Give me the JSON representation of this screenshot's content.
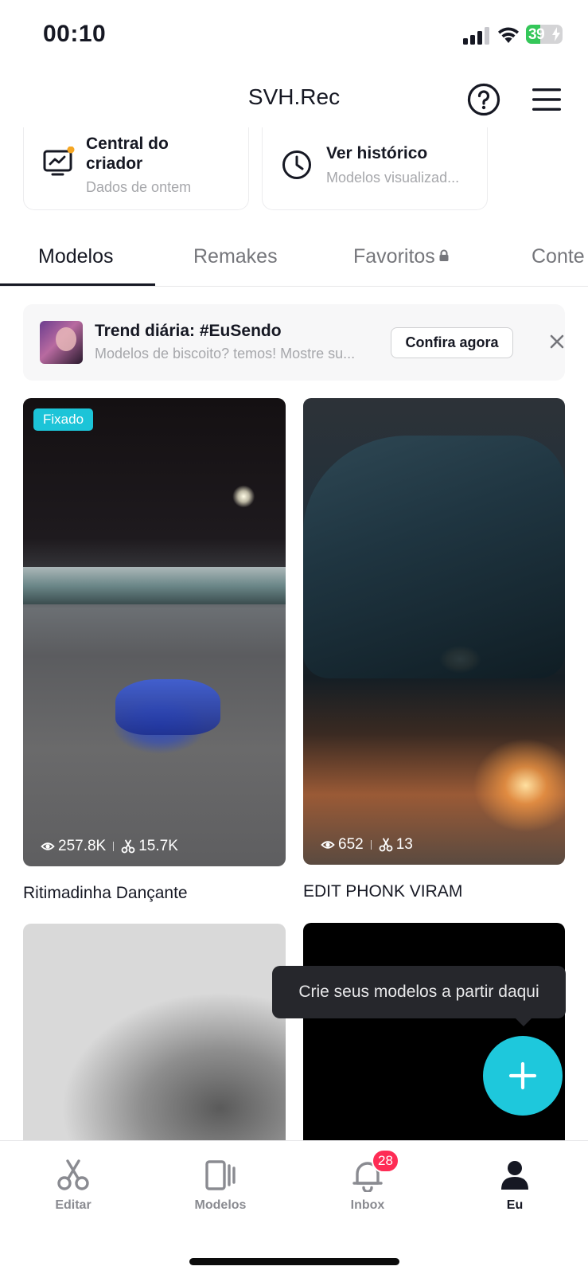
{
  "status_bar": {
    "time": "00:10",
    "battery_level": 39,
    "battery_text": "39",
    "charging": true,
    "signal_icon": "cellular-signal-icon",
    "wifi_icon": "wifi-icon"
  },
  "header": {
    "title": "SVH.Rec",
    "help_icon": "question-circle-icon",
    "menu_icon": "hamburger-menu-icon"
  },
  "cards": {
    "creator": {
      "title_line1": "Central do",
      "title_line2": "criador",
      "subtitle": "Dados de ontem",
      "icon": "analytics-monitor-icon",
      "dot_color": "#f5a623"
    },
    "history": {
      "title": "Ver histórico",
      "subtitle": "Modelos visualizad...",
      "icon": "clock-icon"
    }
  },
  "tabs": [
    {
      "label": "Modelos",
      "active": true
    },
    {
      "label": "Remakes",
      "active": false
    },
    {
      "label": "Favoritos",
      "active": false,
      "locked": true
    },
    {
      "label": "Conte",
      "active": false
    }
  ],
  "trend": {
    "title": "Trend diária: #EuSendo",
    "subtitle": "Modelos de biscoito? temos! Mostre su...",
    "button": "Confira agora",
    "close_icon": "close-icon"
  },
  "templates": [
    {
      "badge": "Fixado",
      "views": "257.8K",
      "uses": "15.7K",
      "title": "Ritimadinha Dançante"
    },
    {
      "views": "652",
      "uses": "13",
      "title": "EDIT PHONK VIRAM"
    }
  ],
  "tooltip": "Crie seus modelos a partir daqui",
  "fab_icon": "plus-icon",
  "bottom_nav": [
    {
      "label": "Editar",
      "icon": "scissors-icon",
      "active": false
    },
    {
      "label": "Modelos",
      "icon": "templates-icon",
      "active": false
    },
    {
      "label": "Inbox",
      "icon": "bell-icon",
      "active": false,
      "badge": "28"
    },
    {
      "label": "Eu",
      "icon": "profile-icon",
      "active": true
    }
  ],
  "colors": {
    "accent": "#1ec8dc",
    "badge": "#fe2c55",
    "text_primary": "#161823",
    "text_secondary": "#a6a7ab"
  }
}
